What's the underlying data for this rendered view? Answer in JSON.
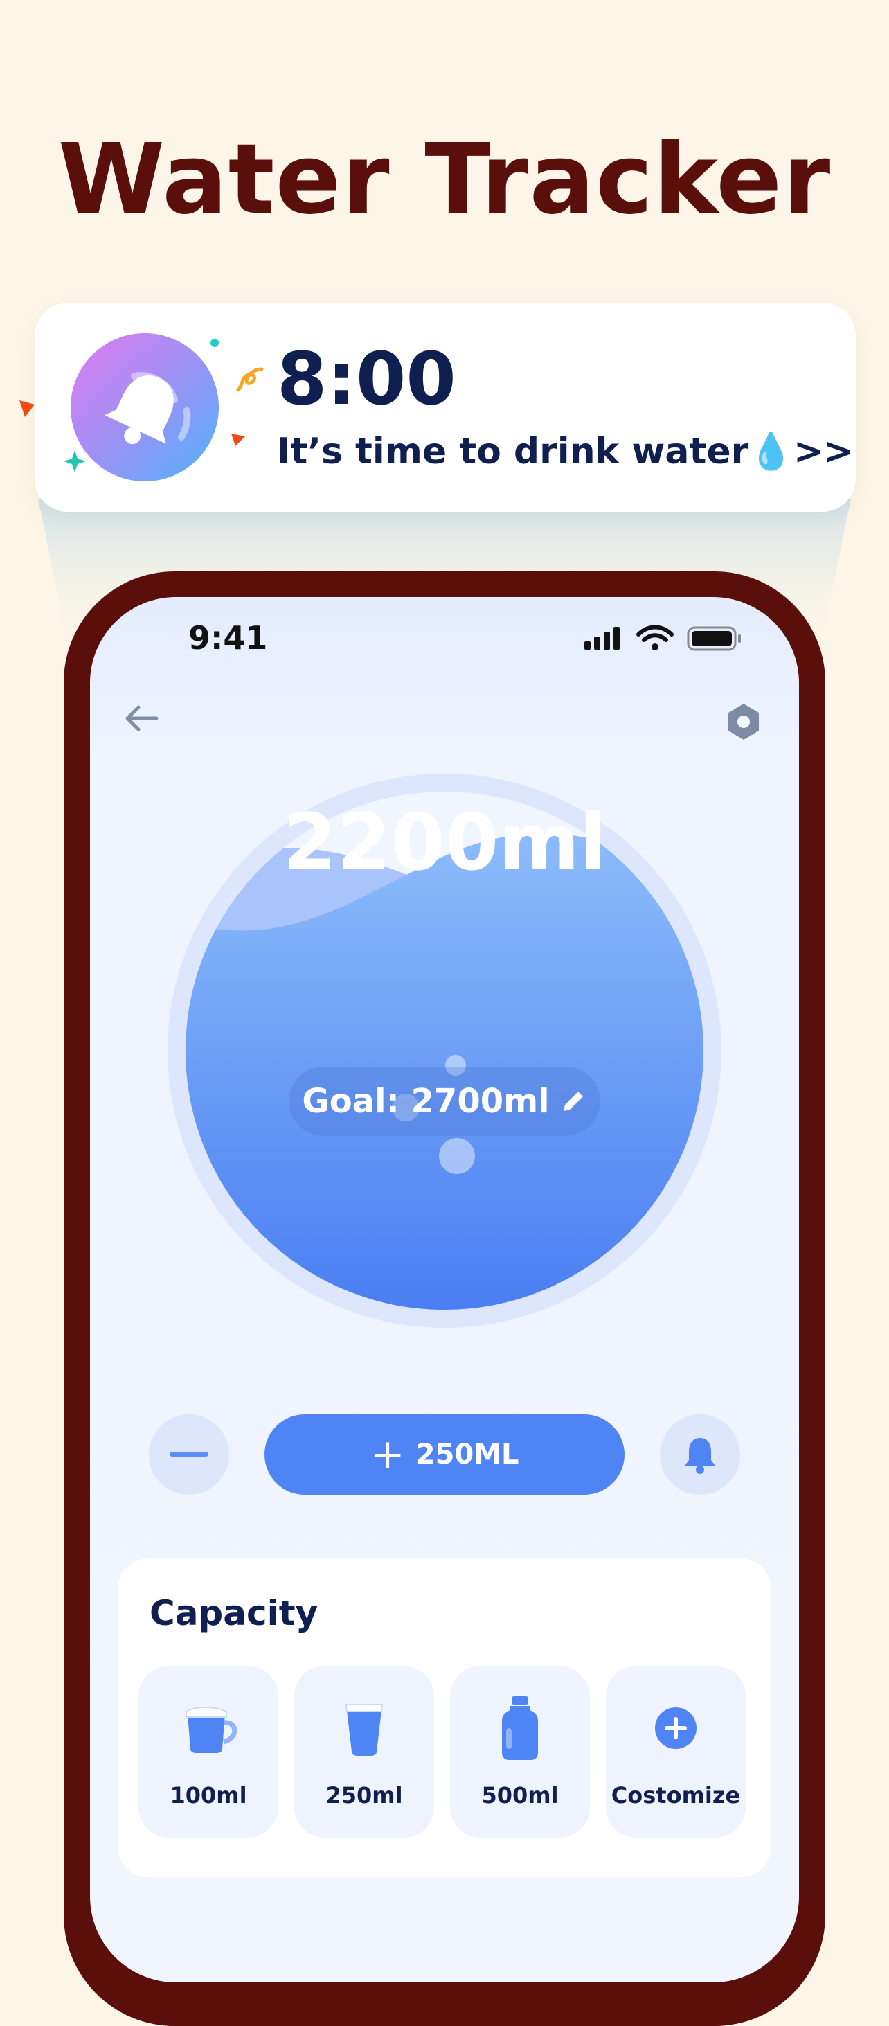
{
  "headline": "Water Tracker",
  "notification": {
    "time": "8:00",
    "message": "It’s time to drink water💧>>",
    "icon": "bell-icon"
  },
  "status_bar": {
    "time": "9:41",
    "icons": [
      "signal-icon",
      "wifi-icon",
      "battery-icon"
    ]
  },
  "tracker": {
    "amount": "2200ml",
    "goal": "Goal: 2700ml",
    "progress_fraction": 0.81
  },
  "controls": {
    "add_label": "250ML",
    "add_symbol": "+"
  },
  "capacity": {
    "title": "Capacity",
    "items": [
      {
        "label": "100ml",
        "icon": "cup-icon"
      },
      {
        "label": "250ml",
        "icon": "glass-icon"
      },
      {
        "label": "500ml",
        "icon": "bottle-icon"
      },
      {
        "label": "Costomize",
        "icon": "plus-circle-icon"
      }
    ]
  },
  "colors": {
    "background": "#fdf6e8",
    "headline": "#5a0f0a",
    "accent_blue": "#4f84f5",
    "text_dark": "#0f1f4f",
    "phone_frame": "#5a0f0a"
  }
}
